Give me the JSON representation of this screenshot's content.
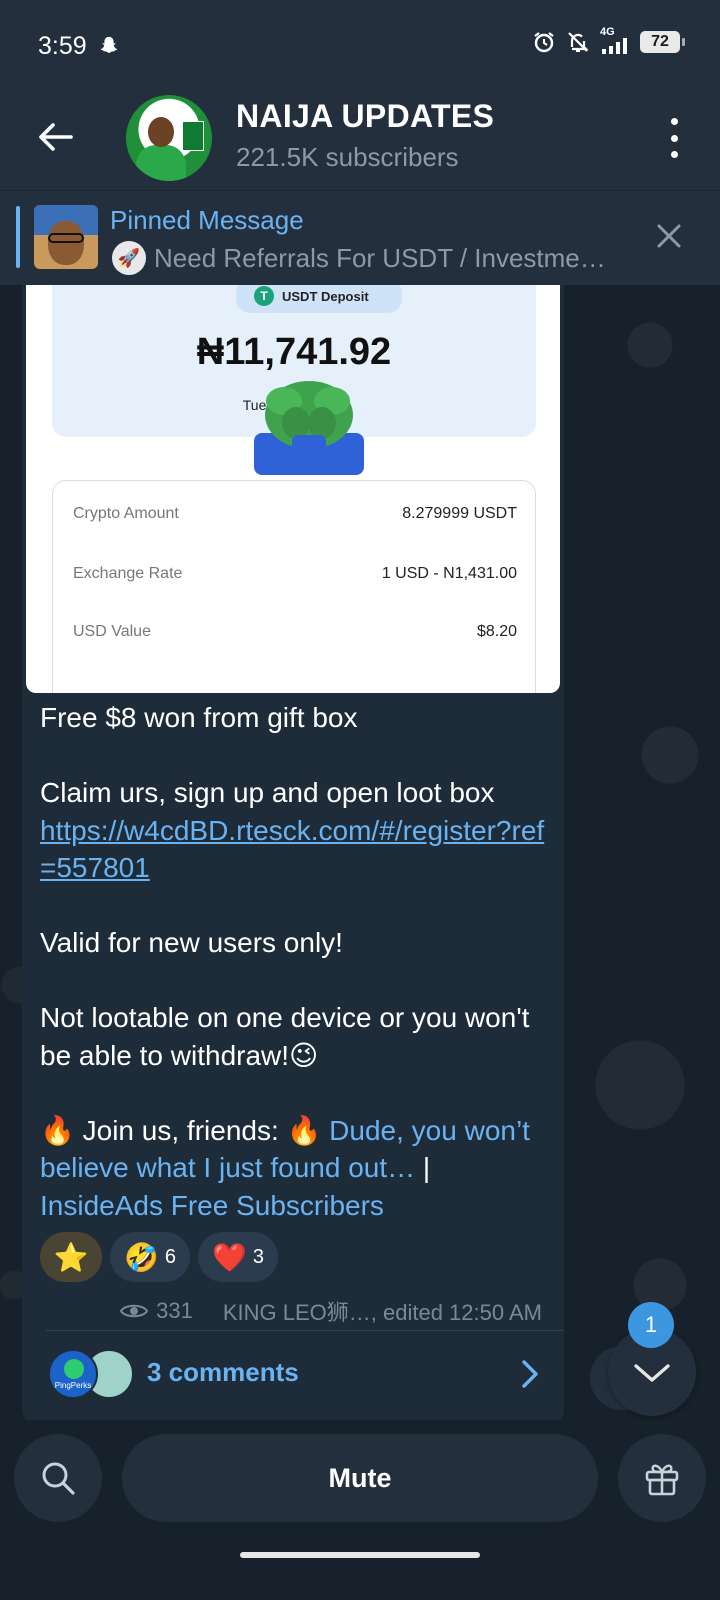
{
  "status": {
    "time": "3:59",
    "network": "4G",
    "battery": "72"
  },
  "header": {
    "title": "NAIJA UPDATES",
    "subtitle": "221.5K subscribers",
    "avatar_text": "NAIJA UPDATES"
  },
  "pinned": {
    "label": "Pinned Message",
    "text": "Need Referrals For USDT / Investme…"
  },
  "receipt": {
    "pill": "USDT Deposit",
    "amount": "₦11,741.92",
    "date": "Tuesday,             :11 AM",
    "rows": [
      {
        "key": "Crypto Amount",
        "value": "8.279999 USDT"
      },
      {
        "key": "Exchange Rate",
        "value": "1 USD  -  N1,431.00"
      },
      {
        "key": "USD Value",
        "value": "$8.20"
      }
    ]
  },
  "message": {
    "line1": "Free $8 won from gift box",
    "line2": "Claim urs, sign up and open loot box",
    "link": "https://w4cdBD.rtesck.com/#/register?ref=557801",
    "line3": "Valid for new users only!",
    "line4": "Not lootable on one device or you won't be able to withdraw!😉",
    "join_prefix": "🔥 Join us, friends: 🔥 ",
    "join_link": "Dude, you won’t believe what I just found out…",
    "separator": " | ",
    "ads_link": "InsideAds Free Subscribers"
  },
  "reactions": [
    {
      "emoji": "⭐",
      "count": ""
    },
    {
      "emoji": "🤣",
      "count": "6"
    },
    {
      "emoji": "❤️",
      "count": "3"
    }
  ],
  "meta": {
    "views": "331",
    "author_edited": "KING LEO狮…, edited 12:50 AM"
  },
  "comments": {
    "label": "3 comments",
    "avatar1_text": "PingPerks"
  },
  "scroll": {
    "unread_count": "1"
  },
  "bottom": {
    "mute_label": "Mute"
  },
  "colors": {
    "accent": "#6ab3f3",
    "header_bg": "#242f3d",
    "chat_bg": "#17212b",
    "bubble_bg": "#1e2c3a",
    "badge": "#3d97e0"
  }
}
